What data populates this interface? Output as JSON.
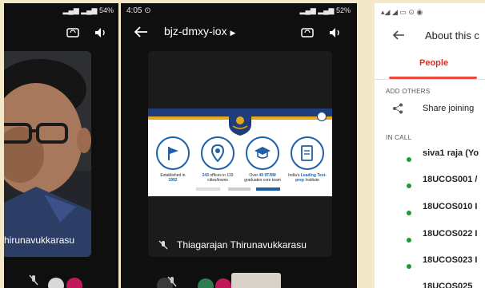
{
  "panel1": {
    "status_text": "54%",
    "participant_name": "hirunavukkarasu"
  },
  "panel2": {
    "time": "4:05",
    "status_text": "52%",
    "meeting_code": "bjz-dmxy-iox",
    "participant_name": "Thiagarajan Thirunavukkarasu",
    "slide": {
      "facts": [
        {
          "pre": "Established in",
          "bold": "1992",
          "post": ""
        },
        {
          "pre": "",
          "bold": "243",
          "post": "offices in 119 cities/towns"
        },
        {
          "pre": "Over",
          "bold": "40 IIT/IIM",
          "post": "graduates core team"
        },
        {
          "pre": "India's",
          "bold": "Leading Test-prep",
          "post": "Institute"
        }
      ]
    }
  },
  "panel3": {
    "title": "About this c",
    "tab_people": "People",
    "add_others_label": "ADD OTHERS",
    "share_label": "Share joining",
    "in_call_label": "IN CALL",
    "participants": [
      "siva1 raja (Yo",
      "18UCOS001 /",
      "18UCOS010 I",
      "18UCOS022 I",
      "18UCOS023 I",
      "18UCOS025"
    ],
    "accent_color": "#d93025",
    "presence_color": "#1a9c3b"
  }
}
